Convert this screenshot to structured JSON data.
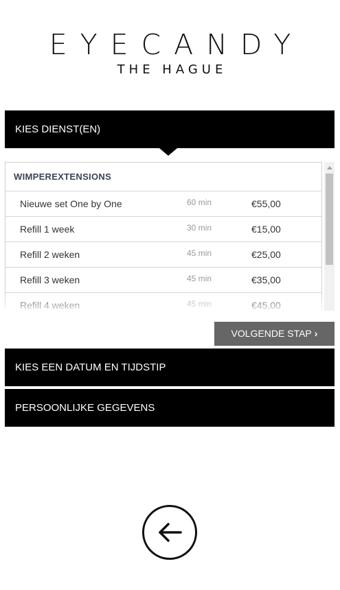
{
  "brand": {
    "name": "EYECANDY",
    "location": "THE HAGUE"
  },
  "steps": {
    "service": "KIES DIENST(EN)",
    "date": "KIES EEN DATUM EN TIJDSTIP",
    "personal": "PERSOONLIJKE GEGEVENS"
  },
  "services": {
    "category": "WIMPEREXTENSIONS",
    "items": [
      {
        "name": "Nieuwe set One by One",
        "duration": "60 min",
        "price": "€55,00"
      },
      {
        "name": "Refill 1 week",
        "duration": "30 min",
        "price": "€15,00"
      },
      {
        "name": "Refill 2 weken",
        "duration": "45 min",
        "price": "€25,00"
      },
      {
        "name": "Refill 3 weken",
        "duration": "45 min",
        "price": "€35,00"
      },
      {
        "name": "Refill 4 weken",
        "duration": "45 min",
        "price": "€45,00"
      }
    ]
  },
  "actions": {
    "next_label": "VOLGENDE STAP",
    "next_icon": "chevron-right-icon",
    "back_icon": "arrow-left-icon"
  },
  "colors": {
    "bar": "#000000",
    "button": "#666666"
  }
}
